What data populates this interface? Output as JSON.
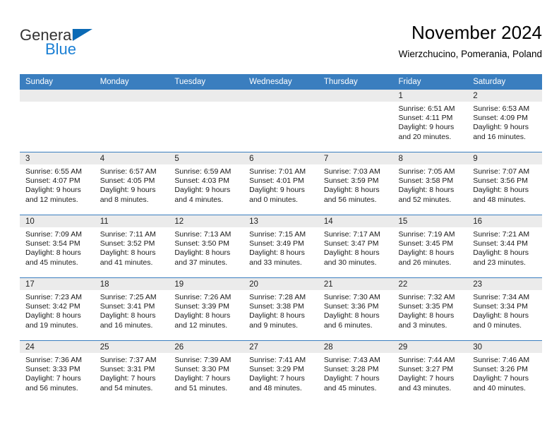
{
  "brand": {
    "name_part1": "General",
    "name_part2": "Blue",
    "triangle_color": "#0b6ab5",
    "blue_color": "#1a7fd4"
  },
  "header": {
    "title": "November 2024",
    "subtitle": "Wierzchucino, Pomerania, Poland"
  },
  "theme": {
    "header_row_bg": "#3a7ebf",
    "daynum_strip_bg": "#ebebeb",
    "row_separator": "#3a7ebf",
    "page_bg": "#ffffff"
  },
  "weekdays": [
    "Sunday",
    "Monday",
    "Tuesday",
    "Wednesday",
    "Thursday",
    "Friday",
    "Saturday"
  ],
  "weeks": [
    [
      {
        "day": "",
        "blank": true
      },
      {
        "day": "",
        "blank": true
      },
      {
        "day": "",
        "blank": true
      },
      {
        "day": "",
        "blank": true
      },
      {
        "day": "",
        "blank": true
      },
      {
        "day": "1",
        "sunrise": "Sunrise: 6:51 AM",
        "sunset": "Sunset: 4:11 PM",
        "daylight1": "Daylight: 9 hours",
        "daylight2": "and 20 minutes."
      },
      {
        "day": "2",
        "sunrise": "Sunrise: 6:53 AM",
        "sunset": "Sunset: 4:09 PM",
        "daylight1": "Daylight: 9 hours",
        "daylight2": "and 16 minutes."
      }
    ],
    [
      {
        "day": "3",
        "sunrise": "Sunrise: 6:55 AM",
        "sunset": "Sunset: 4:07 PM",
        "daylight1": "Daylight: 9 hours",
        "daylight2": "and 12 minutes."
      },
      {
        "day": "4",
        "sunrise": "Sunrise: 6:57 AM",
        "sunset": "Sunset: 4:05 PM",
        "daylight1": "Daylight: 9 hours",
        "daylight2": "and 8 minutes."
      },
      {
        "day": "5",
        "sunrise": "Sunrise: 6:59 AM",
        "sunset": "Sunset: 4:03 PM",
        "daylight1": "Daylight: 9 hours",
        "daylight2": "and 4 minutes."
      },
      {
        "day": "6",
        "sunrise": "Sunrise: 7:01 AM",
        "sunset": "Sunset: 4:01 PM",
        "daylight1": "Daylight: 9 hours",
        "daylight2": "and 0 minutes."
      },
      {
        "day": "7",
        "sunrise": "Sunrise: 7:03 AM",
        "sunset": "Sunset: 3:59 PM",
        "daylight1": "Daylight: 8 hours",
        "daylight2": "and 56 minutes."
      },
      {
        "day": "8",
        "sunrise": "Sunrise: 7:05 AM",
        "sunset": "Sunset: 3:58 PM",
        "daylight1": "Daylight: 8 hours",
        "daylight2": "and 52 minutes."
      },
      {
        "day": "9",
        "sunrise": "Sunrise: 7:07 AM",
        "sunset": "Sunset: 3:56 PM",
        "daylight1": "Daylight: 8 hours",
        "daylight2": "and 48 minutes."
      }
    ],
    [
      {
        "day": "10",
        "sunrise": "Sunrise: 7:09 AM",
        "sunset": "Sunset: 3:54 PM",
        "daylight1": "Daylight: 8 hours",
        "daylight2": "and 45 minutes."
      },
      {
        "day": "11",
        "sunrise": "Sunrise: 7:11 AM",
        "sunset": "Sunset: 3:52 PM",
        "daylight1": "Daylight: 8 hours",
        "daylight2": "and 41 minutes."
      },
      {
        "day": "12",
        "sunrise": "Sunrise: 7:13 AM",
        "sunset": "Sunset: 3:50 PM",
        "daylight1": "Daylight: 8 hours",
        "daylight2": "and 37 minutes."
      },
      {
        "day": "13",
        "sunrise": "Sunrise: 7:15 AM",
        "sunset": "Sunset: 3:49 PM",
        "daylight1": "Daylight: 8 hours",
        "daylight2": "and 33 minutes."
      },
      {
        "day": "14",
        "sunrise": "Sunrise: 7:17 AM",
        "sunset": "Sunset: 3:47 PM",
        "daylight1": "Daylight: 8 hours",
        "daylight2": "and 30 minutes."
      },
      {
        "day": "15",
        "sunrise": "Sunrise: 7:19 AM",
        "sunset": "Sunset: 3:45 PM",
        "daylight1": "Daylight: 8 hours",
        "daylight2": "and 26 minutes."
      },
      {
        "day": "16",
        "sunrise": "Sunrise: 7:21 AM",
        "sunset": "Sunset: 3:44 PM",
        "daylight1": "Daylight: 8 hours",
        "daylight2": "and 23 minutes."
      }
    ],
    [
      {
        "day": "17",
        "sunrise": "Sunrise: 7:23 AM",
        "sunset": "Sunset: 3:42 PM",
        "daylight1": "Daylight: 8 hours",
        "daylight2": "and 19 minutes."
      },
      {
        "day": "18",
        "sunrise": "Sunrise: 7:25 AM",
        "sunset": "Sunset: 3:41 PM",
        "daylight1": "Daylight: 8 hours",
        "daylight2": "and 16 minutes."
      },
      {
        "day": "19",
        "sunrise": "Sunrise: 7:26 AM",
        "sunset": "Sunset: 3:39 PM",
        "daylight1": "Daylight: 8 hours",
        "daylight2": "and 12 minutes."
      },
      {
        "day": "20",
        "sunrise": "Sunrise: 7:28 AM",
        "sunset": "Sunset: 3:38 PM",
        "daylight1": "Daylight: 8 hours",
        "daylight2": "and 9 minutes."
      },
      {
        "day": "21",
        "sunrise": "Sunrise: 7:30 AM",
        "sunset": "Sunset: 3:36 PM",
        "daylight1": "Daylight: 8 hours",
        "daylight2": "and 6 minutes."
      },
      {
        "day": "22",
        "sunrise": "Sunrise: 7:32 AM",
        "sunset": "Sunset: 3:35 PM",
        "daylight1": "Daylight: 8 hours",
        "daylight2": "and 3 minutes."
      },
      {
        "day": "23",
        "sunrise": "Sunrise: 7:34 AM",
        "sunset": "Sunset: 3:34 PM",
        "daylight1": "Daylight: 8 hours",
        "daylight2": "and 0 minutes."
      }
    ],
    [
      {
        "day": "24",
        "sunrise": "Sunrise: 7:36 AM",
        "sunset": "Sunset: 3:33 PM",
        "daylight1": "Daylight: 7 hours",
        "daylight2": "and 56 minutes."
      },
      {
        "day": "25",
        "sunrise": "Sunrise: 7:37 AM",
        "sunset": "Sunset: 3:31 PM",
        "daylight1": "Daylight: 7 hours",
        "daylight2": "and 54 minutes."
      },
      {
        "day": "26",
        "sunrise": "Sunrise: 7:39 AM",
        "sunset": "Sunset: 3:30 PM",
        "daylight1": "Daylight: 7 hours",
        "daylight2": "and 51 minutes."
      },
      {
        "day": "27",
        "sunrise": "Sunrise: 7:41 AM",
        "sunset": "Sunset: 3:29 PM",
        "daylight1": "Daylight: 7 hours",
        "daylight2": "and 48 minutes."
      },
      {
        "day": "28",
        "sunrise": "Sunrise: 7:43 AM",
        "sunset": "Sunset: 3:28 PM",
        "daylight1": "Daylight: 7 hours",
        "daylight2": "and 45 minutes."
      },
      {
        "day": "29",
        "sunrise": "Sunrise: 7:44 AM",
        "sunset": "Sunset: 3:27 PM",
        "daylight1": "Daylight: 7 hours",
        "daylight2": "and 43 minutes."
      },
      {
        "day": "30",
        "sunrise": "Sunrise: 7:46 AM",
        "sunset": "Sunset: 3:26 PM",
        "daylight1": "Daylight: 7 hours",
        "daylight2": "and 40 minutes."
      }
    ]
  ]
}
